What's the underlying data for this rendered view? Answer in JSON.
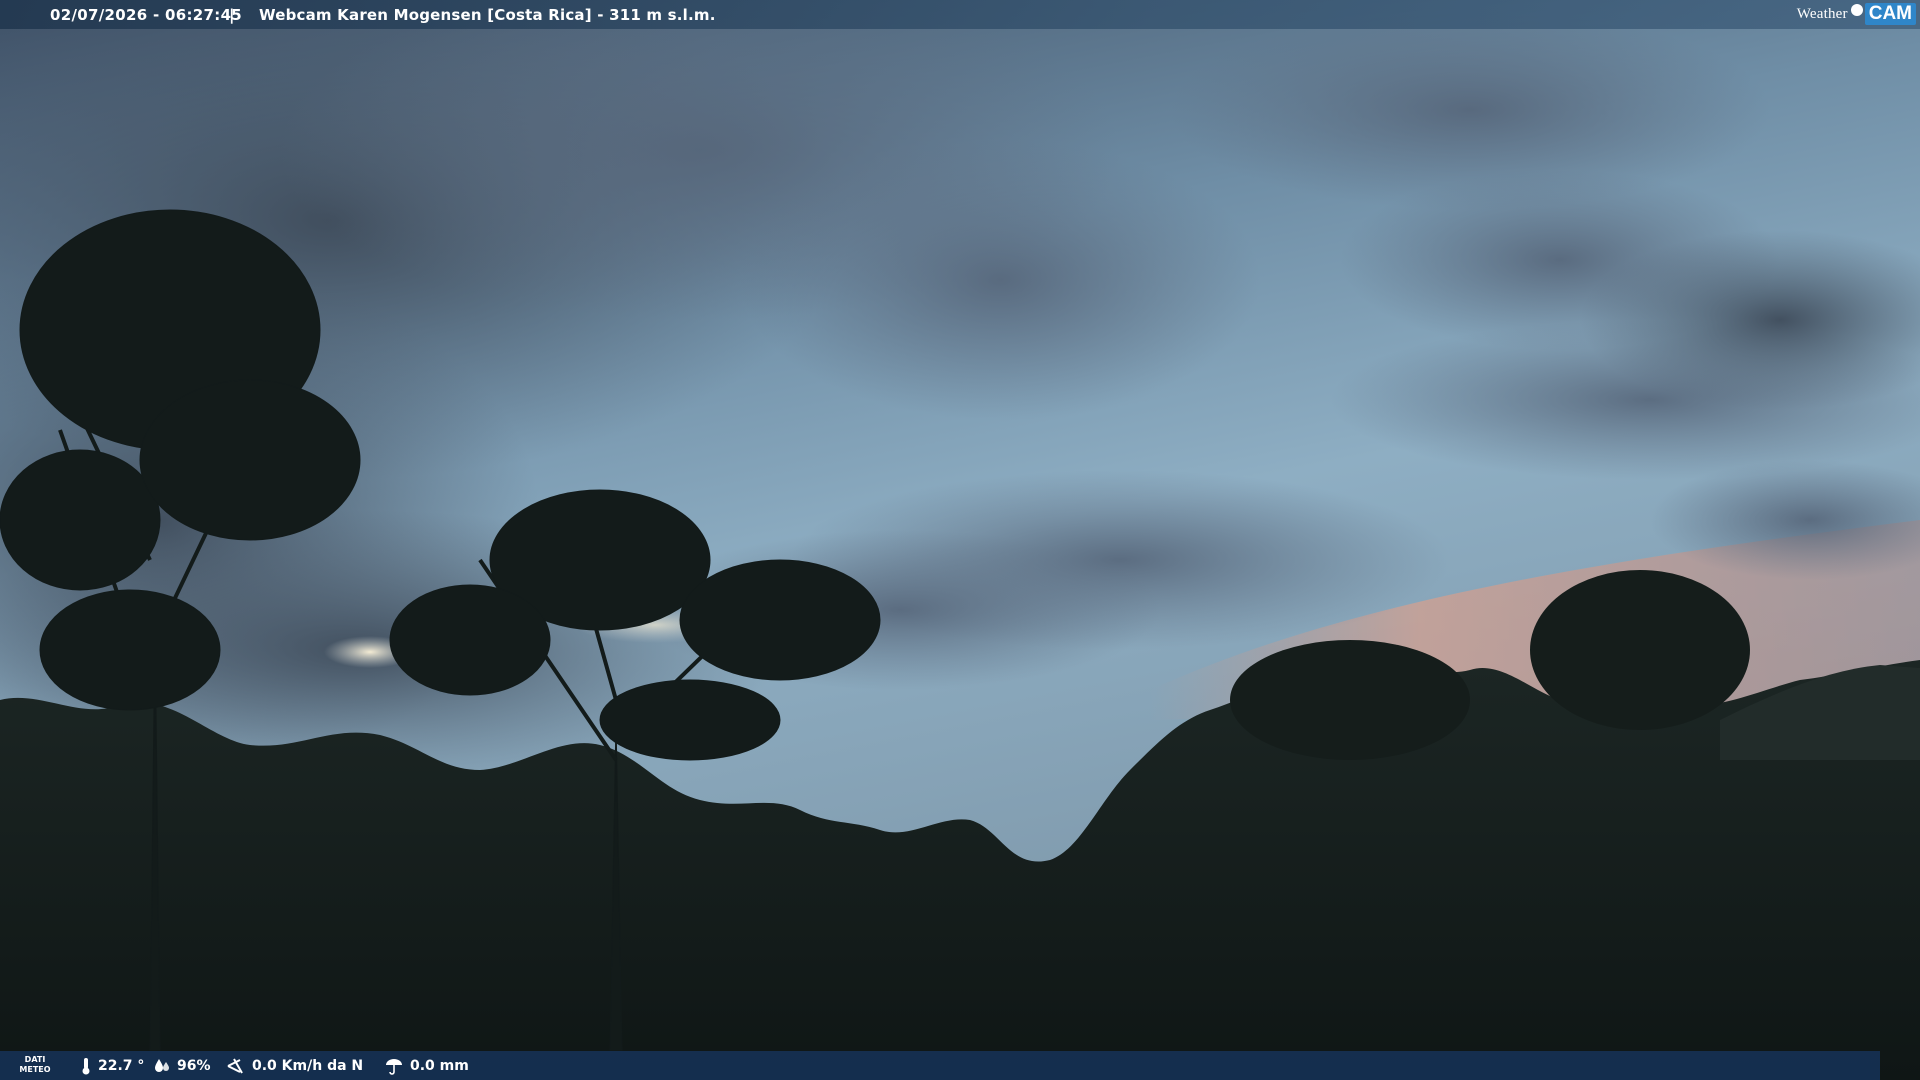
{
  "overlay": {
    "datetime": "02/07/2026 - 06:27:45",
    "separator": "|",
    "camera_title": "Webcam Karen Mogensen [Costa Rica]  - 311 m s.l.m.",
    "logo": {
      "weather": "Weather",
      "cam": "CAM"
    }
  },
  "weather_bar": {
    "label_line1": "DATI",
    "label_line2": "METEO",
    "temperature": "22.7 °",
    "humidity": "96%",
    "wind": "0.0 Km/h da N",
    "rain": "0.0 mm",
    "icons": [
      "thermometer-icon",
      "humidity-drops-icon",
      "wind-icon",
      "rain-gauge-icon"
    ]
  },
  "scene_colors": {
    "sky_top": "#3a4d63",
    "sky_mid": "#7f9fb6",
    "sky_horizon_glow": "#c79a8a",
    "clouds": "#4c5b6c",
    "trees": "#161e1c",
    "bar": "#163256"
  }
}
